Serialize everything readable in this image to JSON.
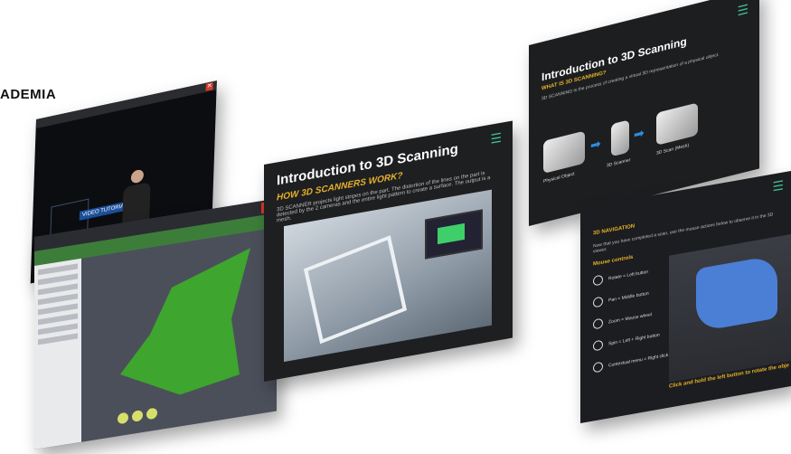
{
  "brand": {
    "label": "ADEMIA"
  },
  "s1": {
    "close": "✕",
    "badge": "VIDEO TUTORIAL"
  },
  "s2": {
    "close": "✕"
  },
  "s3": {
    "title": "Introduction to 3D Scanning",
    "subtitle": "HOW 3D SCANNERS WORK?",
    "paragraph": "3D SCANNER projects light stripes on the part. The distortion of the lines on the part is detected by the 2 cameras and the entire light pattern to create a surface. The output is a mesh."
  },
  "s4": {
    "title": "Introduction to 3D Scanning",
    "subtitle": "WHAT IS 3D SCANNING?",
    "paragraph": "3D SCANNING is the process of creating a virtual 3D representation of a physical object.",
    "flow": [
      "Physical Object",
      "3D Scanner",
      "3D Scan (Mesh)"
    ]
  },
  "s5": {
    "subtitle": "3D NAVIGATION",
    "paragraph": "Now that you have completed a scan, use the mouse actions below to observe it in the 3D viewer.",
    "mouse_title": "Mouse controls",
    "controls": [
      "Rotate = Left button",
      "Pan = Middle button",
      "Zoom = Mouse wheel",
      "Spin = Left + Right button",
      "Contextual menu = Right click"
    ],
    "footer": "Click and hold the left button to rotate the obje"
  },
  "icons": {
    "menu": "hamburger-menu-icon",
    "arrow": "arrow-right-icon",
    "close": "close-icon"
  },
  "colors": {
    "accent": "#e8b22a",
    "menu": "#3fc08f",
    "close": "#d9342b",
    "mesh": "#3ea52e"
  }
}
